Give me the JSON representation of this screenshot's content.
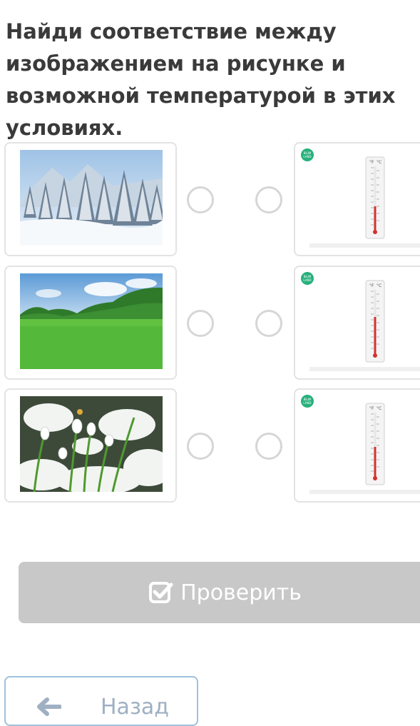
{
  "task": {
    "title": "Найди соответствие между изображением на рисунке и возможной температурой в этих условиях."
  },
  "left_items": [
    {
      "icon": "winter-forest-image"
    },
    {
      "icon": "green-meadow-image"
    },
    {
      "icon": "snowdrops-in-snow-image"
    }
  ],
  "right_items": [
    {
      "icon": "thermometer-image"
    },
    {
      "icon": "thermometer-image"
    },
    {
      "icon": "thermometer-image"
    }
  ],
  "badge_text": "BILIM LAND",
  "thermometer_labels": {
    "celsius": "°C",
    "fahrenheit": "°F"
  },
  "buttons": {
    "check_label": "Проверить",
    "back_label": "Назад"
  },
  "colors": {
    "badge": "#27b07b",
    "check_button": "#c8c8c8",
    "back_border": "#9fc0dd",
    "thermometer_liquid": "#d2322d"
  }
}
